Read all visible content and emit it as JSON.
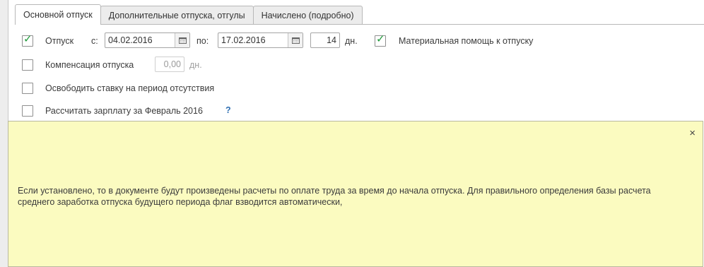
{
  "tabs": [
    {
      "label": "Основной отпуск",
      "active": true
    },
    {
      "label": "Дополнительные отпуска, отгулы",
      "active": false
    },
    {
      "label": "Начислено (подробно)",
      "active": false
    }
  ],
  "vacation": {
    "checked": true,
    "label": "Отпуск",
    "from_label": "с:",
    "from_value": "04.02.2016",
    "to_label": "по:",
    "to_value": "17.02.2016",
    "days_value": "14",
    "days_unit": "дн.",
    "aid_checked": true,
    "aid_label": "Материальная помощь к отпуску"
  },
  "compensation": {
    "checked": false,
    "label": "Компенсация отпуска",
    "value": "0,00",
    "unit": "дн."
  },
  "release_rate": {
    "checked": false,
    "label": "Освободить ставку на период отсутствия"
  },
  "calc_salary": {
    "checked": false,
    "label": "Рассчитать зарплату за Февраль 2016",
    "help": "?"
  },
  "tooltip": {
    "close": "×",
    "text": "Если установлено, то в документе будут произведены расчеты по оплате труда за время до начала отпуска. Для правильного определения базы расчета среднего заработка отпуска будущего периода флаг взводится автоматически,"
  },
  "colors": {
    "check": "#1f9a3a",
    "tooltip_bg": "#fbfbc0",
    "help": "#2f6fb2"
  }
}
